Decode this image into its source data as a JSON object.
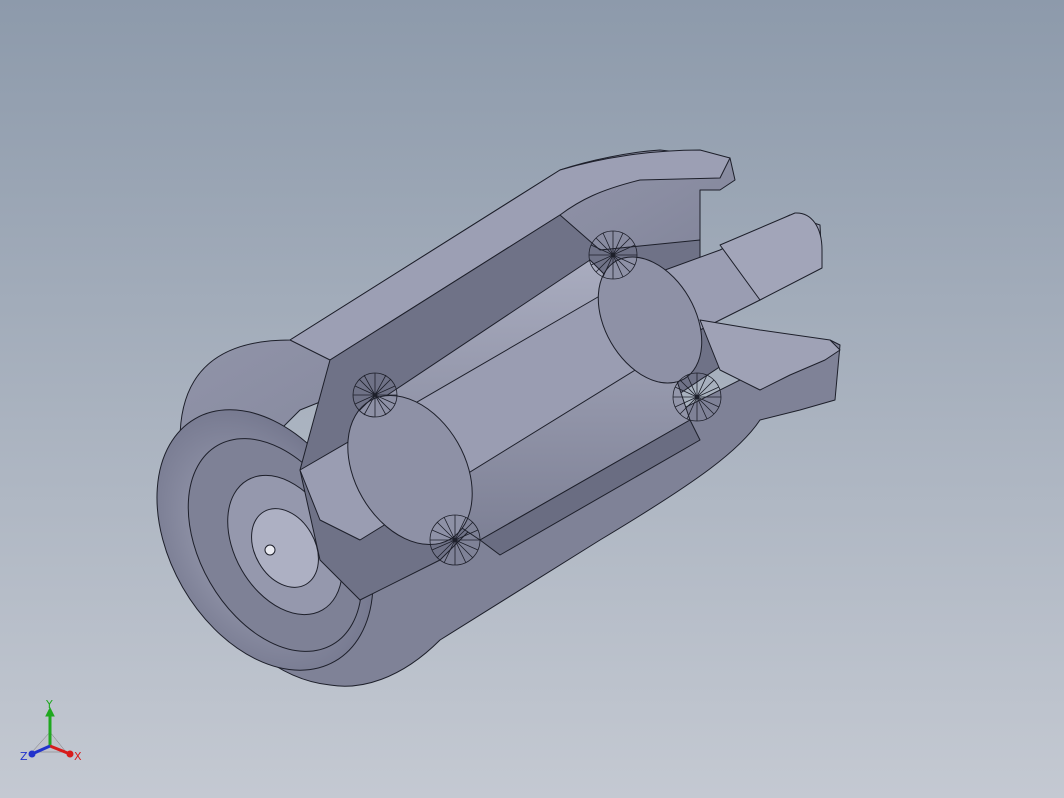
{
  "viewport": {
    "background_top": "#8d9aab",
    "background_bottom": "#c4c9d2"
  },
  "model": {
    "body_color": "#8b8ea3",
    "light_color": "#b3b6c8",
    "dark_color": "#5d6075",
    "edge_color": "#1d1f2a"
  },
  "triad": {
    "x_label": "X",
    "y_label": "Y",
    "z_label": "Z",
    "x_color": "#d81b1b",
    "y_color": "#1fa81f",
    "z_color": "#2233cc"
  }
}
